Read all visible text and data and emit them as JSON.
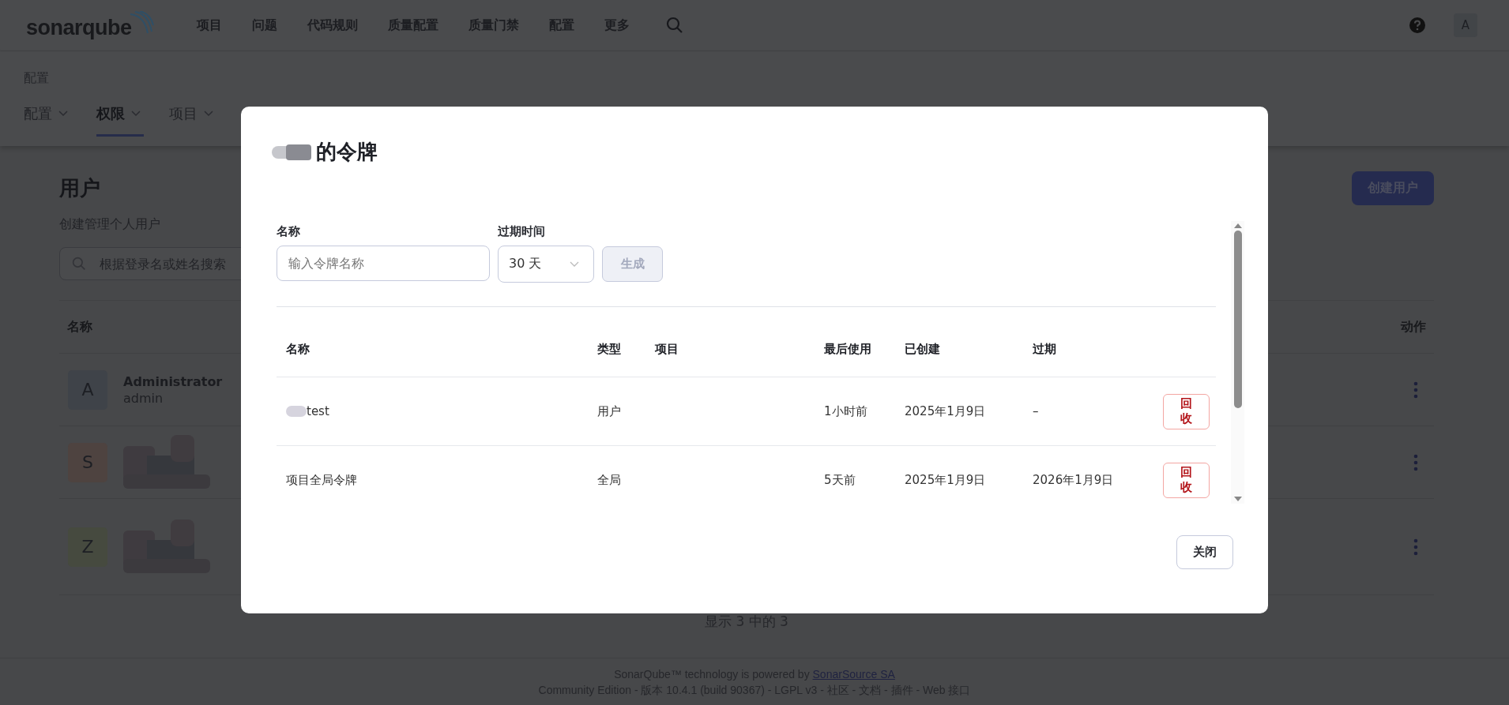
{
  "top_nav": {
    "logo": "sonarqube",
    "items": [
      "项目",
      "问题",
      "代码规则",
      "质量配置",
      "质量门禁",
      "配置",
      "更多"
    ],
    "avatar": "A"
  },
  "breadcrumb": "配置",
  "sub_tabs": [
    {
      "label": "配置",
      "selected": false
    },
    {
      "label": "权限",
      "selected": true
    },
    {
      "label": "项目",
      "selected": false
    }
  ],
  "page": {
    "title": "用户",
    "description": "创建管理个人用户",
    "search_placeholder": "根据登录名或姓名搜索",
    "create_button": "创建用户",
    "columns": [
      "名称",
      "动作"
    ],
    "users": [
      {
        "initial": "A",
        "name": "Administrator",
        "login": "admin",
        "color": "#3f4349"
      },
      {
        "initial": "S",
        "color": "#4e4340"
      },
      {
        "initial": "Z",
        "color": "#464a3f"
      }
    ],
    "count": "显示 3 中的 3"
  },
  "footer": {
    "powered_by": "SonarQube™ technology is powered by",
    "link": "SonarSource SA",
    "line_2": "Community Edition - 版本 10.4.1 (build 90367) - LGPL v3 - 社区 - 文档 - 插件 - Web 接口"
  },
  "modal": {
    "title": "的令牌",
    "form": {
      "name_label": "名称",
      "name_placeholder": "输入令牌名称",
      "expiry_label": "过期时间",
      "expiry_value": "30 天",
      "generate_button": {
        "label": "生成",
        "disabled": true
      }
    },
    "columns": [
      "名称",
      "类型",
      "项目",
      "最后使用",
      "已创建",
      "过期"
    ],
    "tokens": [
      {
        "name": "test",
        "type": "用户",
        "last_used": "1小时前",
        "created": "2025年1月9日",
        "expires": "–",
        "revoke": "回收"
      },
      {
        "name": "项目全局令牌",
        "type": "全局",
        "last_used": "5天前",
        "created": "2025年1月9日",
        "expires": "2026年1月9日",
        "revoke": "回收"
      }
    ],
    "close_button": "关闭"
  }
}
